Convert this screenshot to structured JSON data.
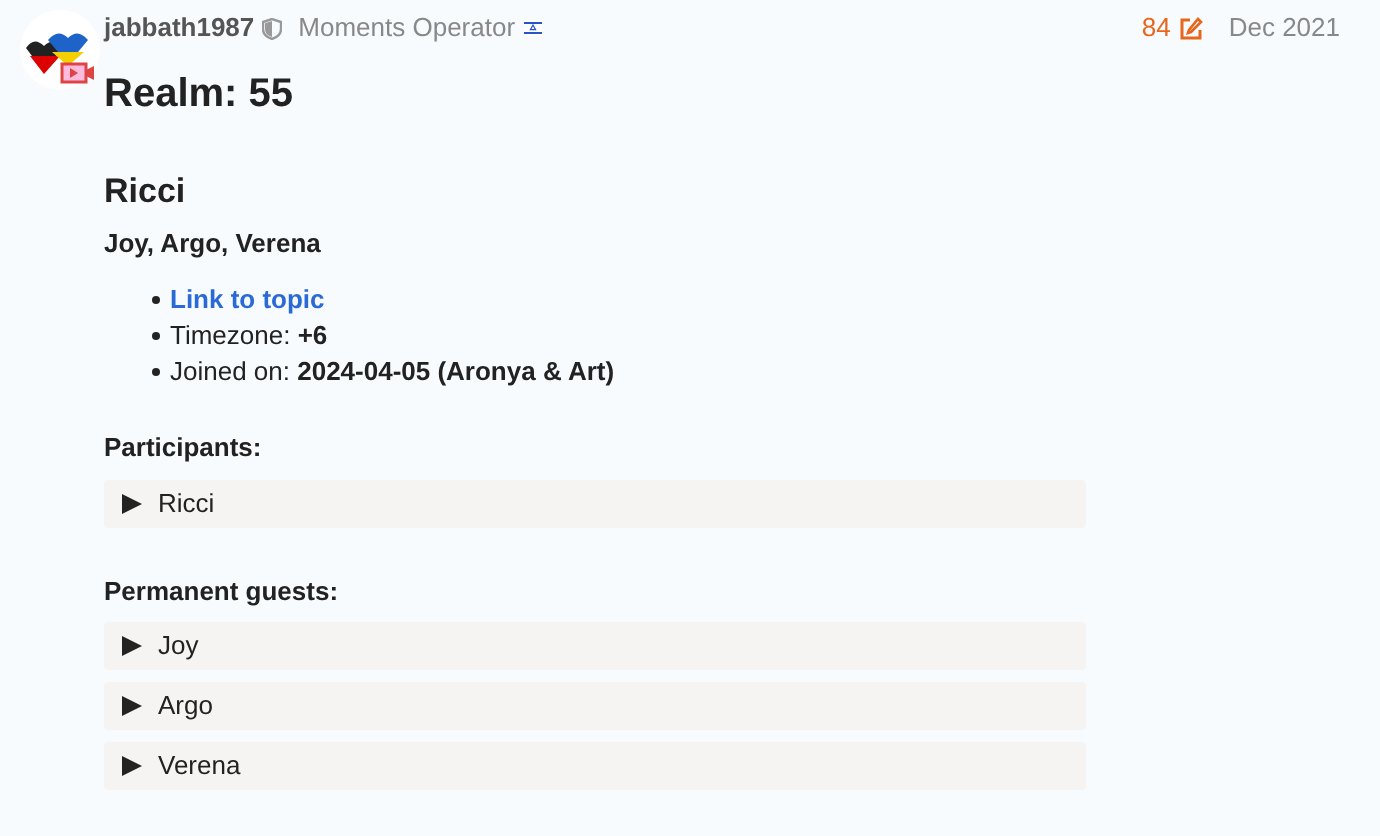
{
  "post": {
    "username": "jabbath1987",
    "user_title": "Moments Operator",
    "likes": "84",
    "date": "Dec 2021"
  },
  "title": "Realm: 55",
  "heading": "Ricci",
  "members": "Joy, Argo, Verena",
  "facts": [
    {
      "kind": "link",
      "text": "Link to topic"
    },
    {
      "kind": "plain",
      "text": "Timezone: **+6**"
    },
    {
      "kind": "plain",
      "text": "Joined on: **2024-04-05 (Aronya & Art)**"
    }
  ],
  "sections": [
    {
      "label": "Participants:",
      "items": [
        {
          "label": "Ricci",
          "expanded": false
        }
      ]
    },
    {
      "label": "Permanent guests:",
      "items": [
        {
          "label": "Joy",
          "expanded": false
        },
        {
          "label": "Argo",
          "expanded": false
        },
        {
          "label": "Verena",
          "expanded": false
        }
      ]
    }
  ]
}
